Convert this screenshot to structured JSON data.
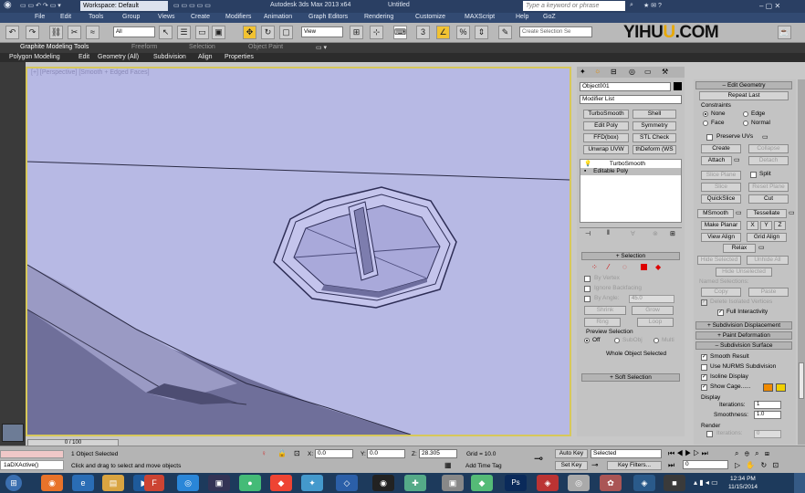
{
  "title_bar": {
    "workspace": "Workspace: Default",
    "app_title": "Autodesk 3ds Max 2013 x64",
    "doc_title": "Untitled",
    "search_placeholder": "Type a keyword or phrase"
  },
  "menu": [
    "File",
    "Edit",
    "Tools",
    "Group",
    "Views",
    "Create",
    "Modifiers",
    "Animation",
    "Graph Editors",
    "Rendering",
    "Customize",
    "MAXScript",
    "Help",
    "GoZ"
  ],
  "toolbar": {
    "filter_value": "All",
    "view_value": "View",
    "selection_set_placeholder": "Create Selection Se"
  },
  "watermark": {
    "text_a": "YIHU",
    "text_b": "U",
    "text_c": ".COM"
  },
  "ribbon": {
    "tabs": [
      "Graphite Modeling Tools",
      "Freeform",
      "Selection",
      "Object Paint"
    ],
    "subtabs": [
      "Polygon Modeling",
      "Edit",
      "Geometry (All)",
      "Subdivision",
      "Align",
      "Properties"
    ]
  },
  "viewport": {
    "label": "[+] [Perspective] [Smooth + Edged Faces]"
  },
  "command_panel": {
    "object_name": "Object001",
    "modifier_list": "Modifier List",
    "modifier_buttons": [
      "TurboSmooth",
      "Shell",
      "Edit Poly",
      "Symmetry",
      "FFD(box)",
      "STL Check",
      "Unwrap UVW",
      "thDeform (WS"
    ],
    "stack": [
      "TurboSmooth",
      "Editable Poly"
    ],
    "selection": {
      "header": "Selection",
      "by_vertex": "By Vertex",
      "ignore_backfacing": "Ignore Backfacing",
      "by_angle": "By Angle:",
      "angle_value": "45.0",
      "shrink": "Shrink",
      "grow": "Grow",
      "ring": "Ring",
      "loop": "Loop",
      "preview_label": "Preview Selection",
      "preview_options": [
        "Off",
        "SubObj",
        "Multi"
      ],
      "status": "Whole Object Selected"
    },
    "soft_selection": "Soft Selection"
  },
  "edit_geometry": {
    "header": "Edit Geometry",
    "repeat_last": "Repeat Last",
    "constraints_label": "Constraints",
    "constraints": [
      "None",
      "Edge",
      "Face",
      "Normal"
    ],
    "preserve_uvs": "Preserve UVs",
    "create": "Create",
    "collapse": "Collapse",
    "attach": "Attach",
    "detach": "Detach",
    "slice_plane": "Slice Plane",
    "split": "Split",
    "slice": "Slice",
    "reset_plane": "Reset Plane",
    "quickslice": "QuickSlice",
    "cut": "Cut",
    "msmooth": "MSmooth",
    "tessellate": "Tessellate",
    "make_planar": "Make Planar",
    "axes": [
      "X",
      "Y",
      "Z"
    ],
    "view_align": "View Align",
    "grid_align": "Grid Align",
    "relax": "Relax",
    "hide_selected": "Hide Selected",
    "unhide_all": "Unhide All",
    "hide_unselected": "Hide Unselected",
    "named_selections": "Named Selections:",
    "copy": "Copy",
    "paste": "Paste",
    "delete_isolated": "Delete Isolated Vertices",
    "full_interactivity": "Full Interactivity"
  },
  "rollouts": [
    "Subdivision Displacement",
    "Paint Deformation",
    "Subdivision Surface"
  ],
  "subdivision_surface": {
    "smooth_result": "Smooth Result",
    "use_nurms": "Use NURMS Subdivision",
    "isoline_display": "Isoline Display",
    "show_cage": "Show Cage......",
    "display_label": "Display",
    "iterations_label": "Iterations:",
    "iterations_value": "1",
    "smoothness_label": "Smoothness:",
    "smoothness_value": "1.0",
    "render_label": "Render",
    "render_iterations_value": "0",
    "cage_color_a": "#f08a00",
    "cage_color_b": "#f0d000"
  },
  "status": {
    "time_slider": "0 / 100",
    "objects_selected": "1 Object Selected",
    "prompt": "Click and drag to select and move objects",
    "x_label": "X:",
    "x_value": "0.0",
    "y_label": "Y:",
    "y_value": "0.0",
    "z_label": "Z:",
    "z_value": "28.305",
    "grid": "Grid = 10.0",
    "add_time_tag": "Add Time Tag",
    "auto_key": "Auto Key",
    "selected": "Selected",
    "set_key": "Set Key",
    "key_filters": "Key Filters...",
    "frame": "0",
    "listener": "1aDXActive()"
  },
  "clock": {
    "time": "12:34 PM",
    "date": "11/15/2014"
  }
}
